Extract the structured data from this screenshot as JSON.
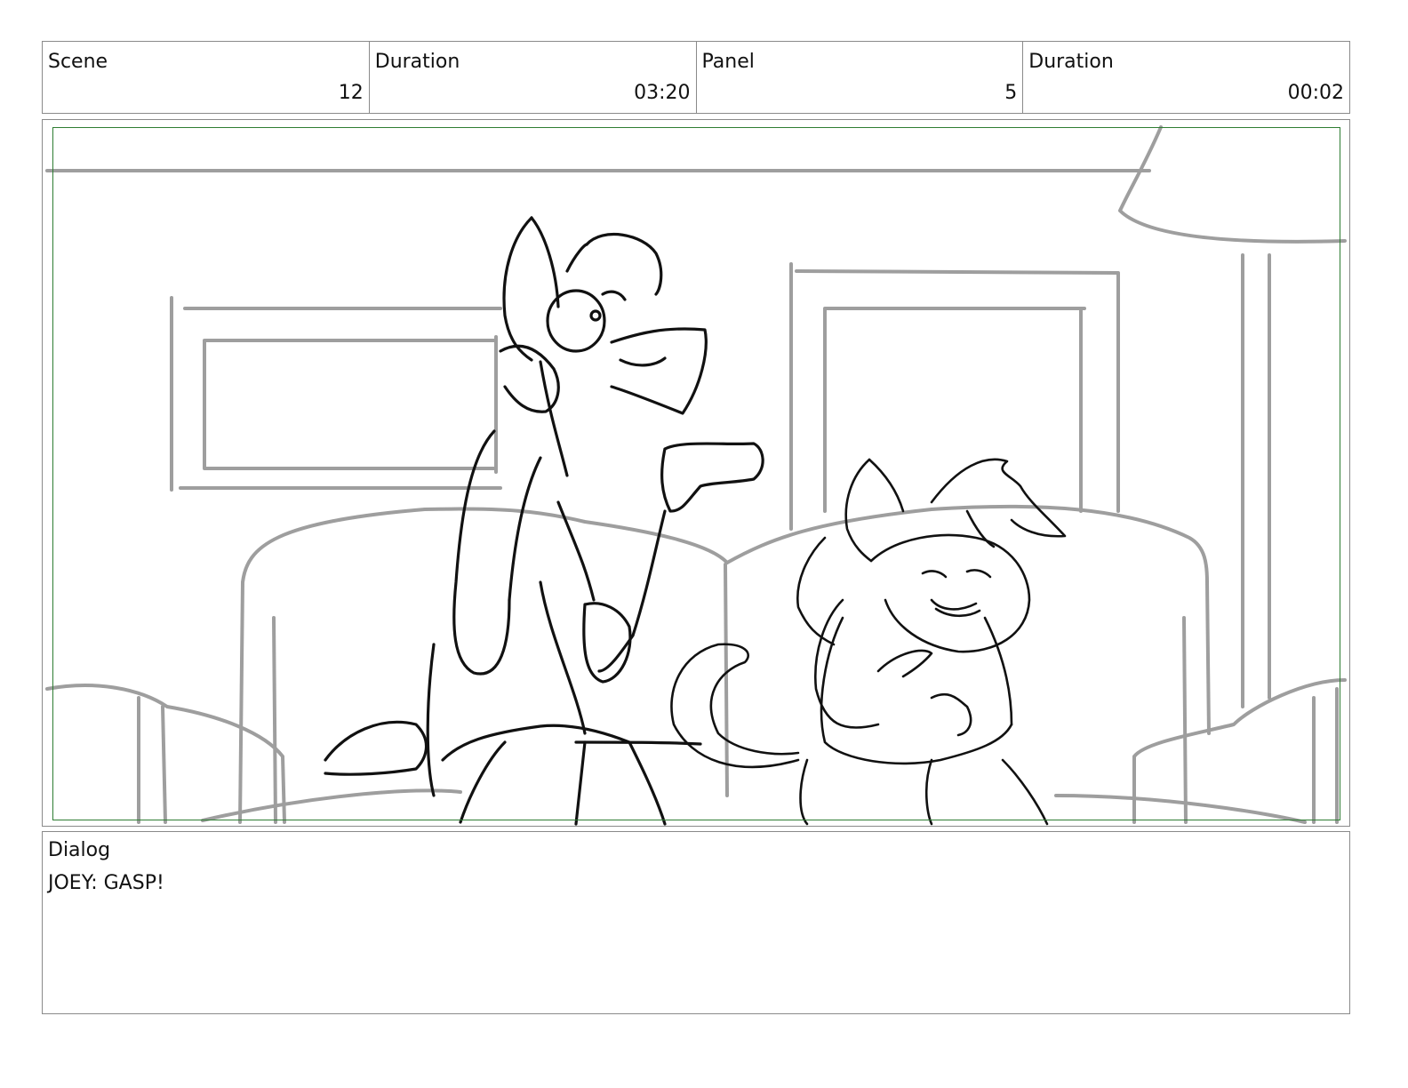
{
  "header": {
    "cells": [
      {
        "label": "Scene",
        "value": "12"
      },
      {
        "label": "Duration",
        "value": "03:20"
      },
      {
        "label": "Panel",
        "value": "5"
      },
      {
        "label": "Duration",
        "value": "00:02"
      }
    ]
  },
  "dialog": {
    "label": "Dialog",
    "text": "JOEY: GASP!"
  },
  "colors": {
    "safe_area": "#2e7d32",
    "background_lines": "#9e9e9e",
    "character_lines": "#111111"
  }
}
